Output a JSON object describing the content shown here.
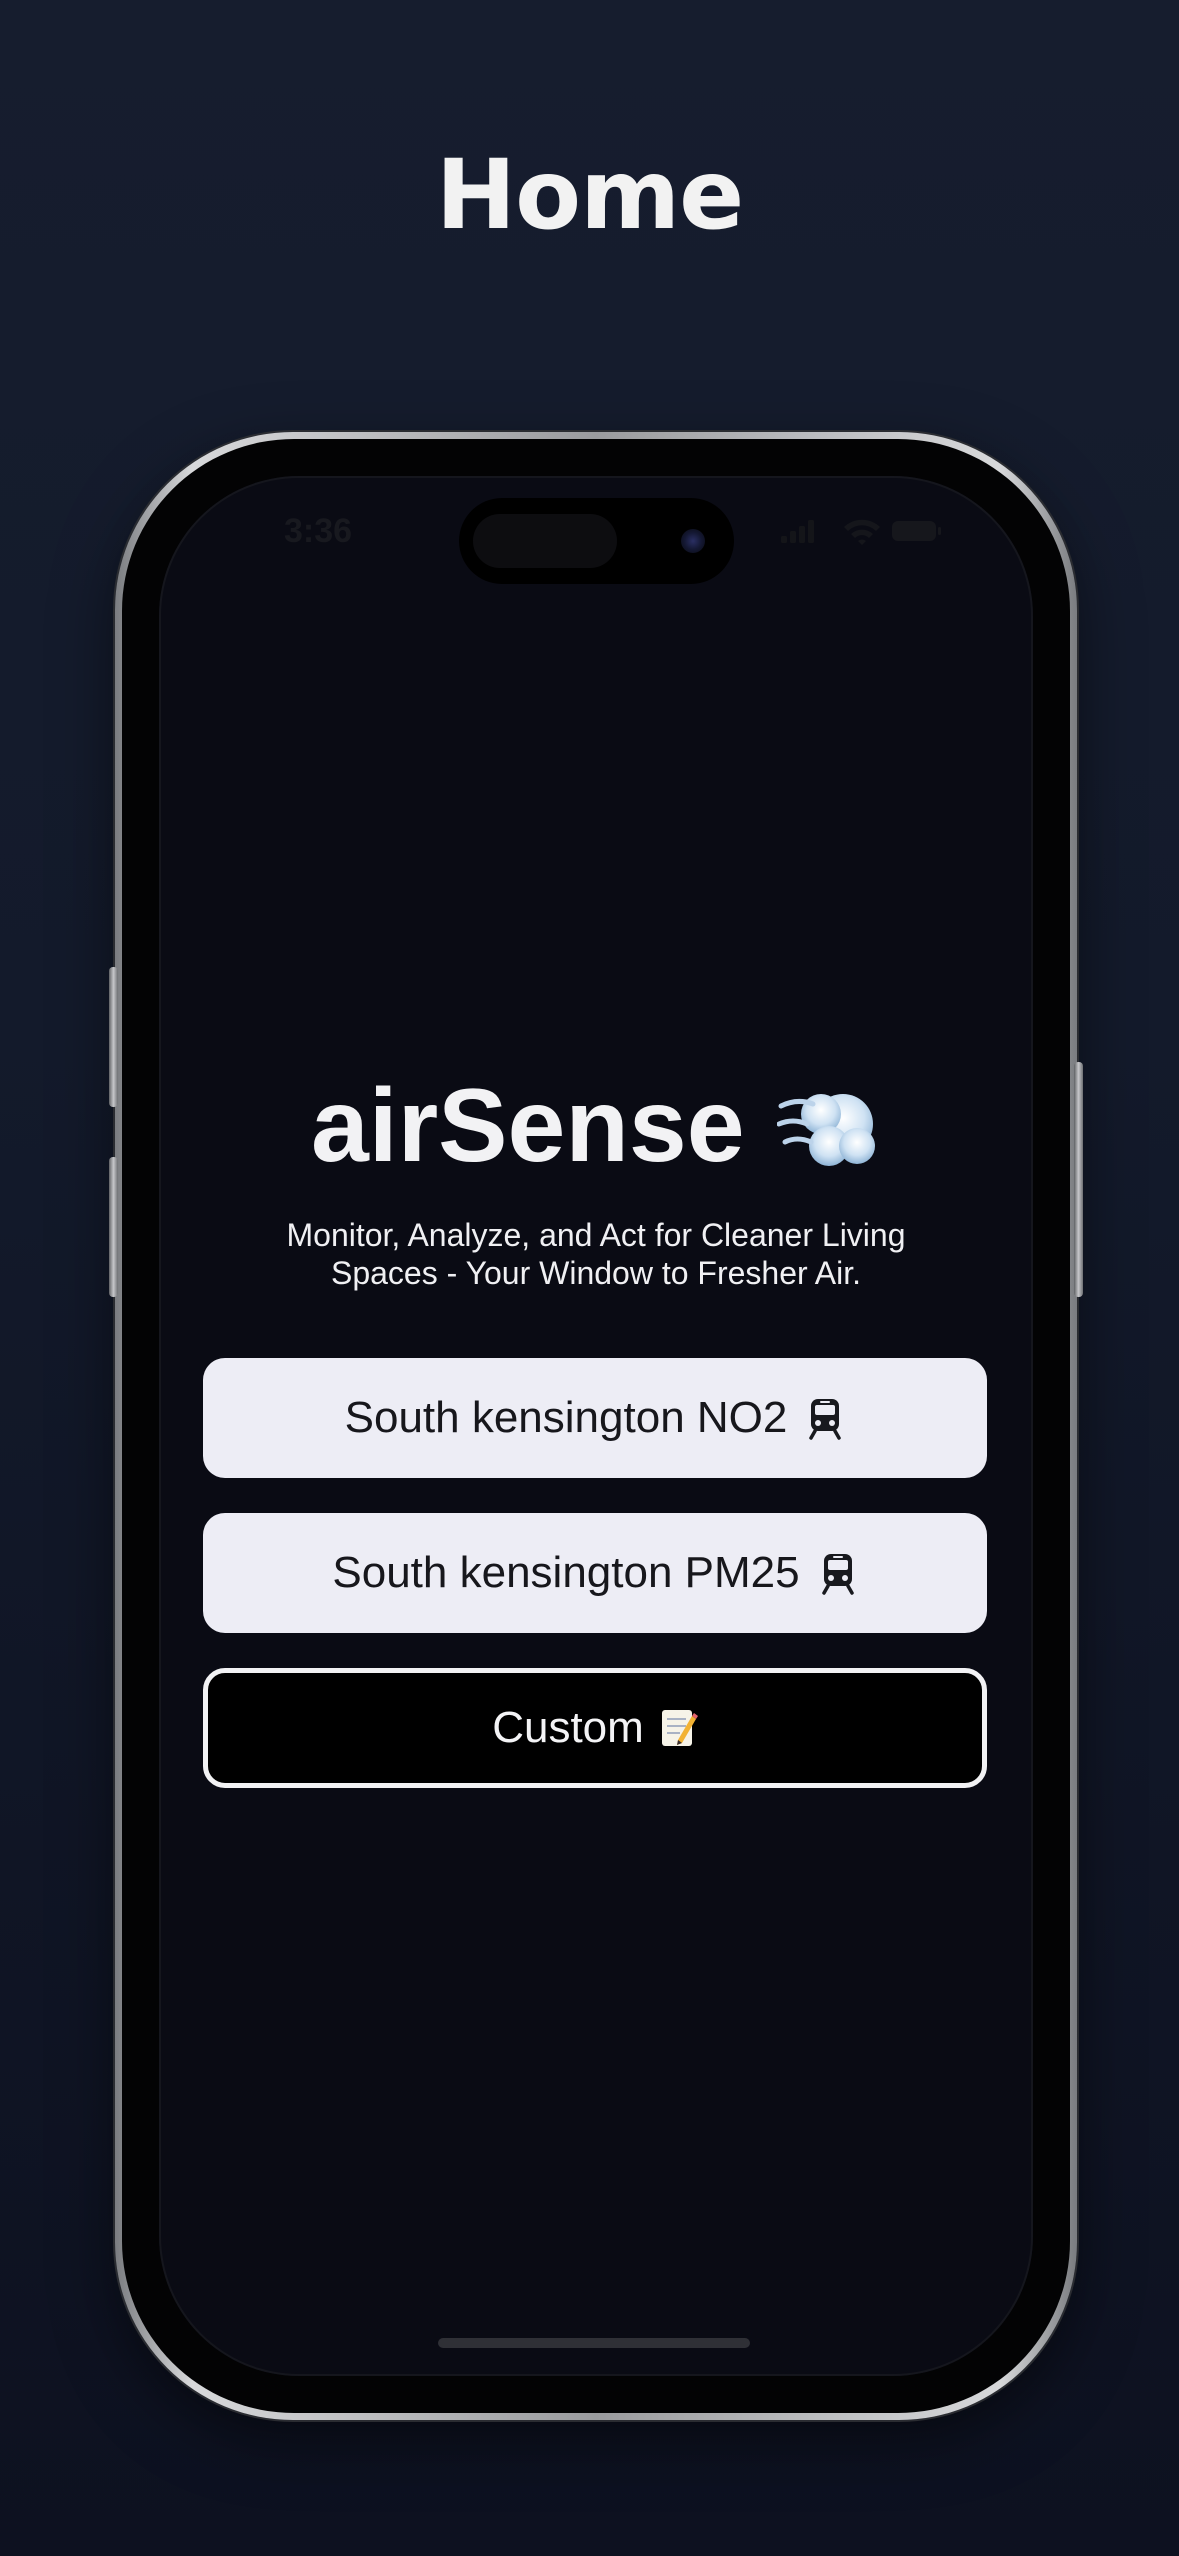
{
  "page": {
    "title": "Home"
  },
  "status_bar": {
    "time": "3:36"
  },
  "app": {
    "name": "airSense",
    "logo_icon": "dashing-away-cloud-icon",
    "tagline": "Monitor, Analyze, and Act for Cleaner Living Spaces - Your Window to Fresher Air."
  },
  "buttons": [
    {
      "label": "South kensington NO2",
      "icon": "train-icon",
      "style": "filled"
    },
    {
      "label": "South kensington PM25",
      "icon": "train-icon",
      "style": "filled"
    },
    {
      "label": "Custom",
      "icon": "memo-icon",
      "style": "outline"
    }
  ],
  "colors": {
    "background": "#161d2e",
    "screen": "#0a0b14",
    "button_fill": "#ededf5",
    "button_text": "#17171c",
    "outline": "#f2f2f4"
  }
}
